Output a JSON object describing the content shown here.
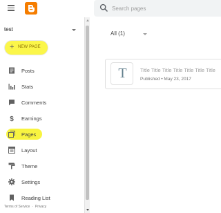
{
  "header": {
    "search_placeholder": "Search pages",
    "menu_icon": "hamburger-menu-icon",
    "logo_icon": "blogger-logo-icon",
    "search_icon": "search-icon",
    "logo_color": "#f57d00"
  },
  "sidebar": {
    "blog_name": "test",
    "new_page_label": "NEW PAGE",
    "items": [
      {
        "label": "Posts",
        "icon": "posts-icon"
      },
      {
        "label": "Stats",
        "icon": "stats-icon"
      },
      {
        "label": "Comments",
        "icon": "comments-icon"
      },
      {
        "label": "Earnings",
        "icon": "dollar-icon"
      },
      {
        "label": "Pages",
        "icon": "pages-icon",
        "active": true
      },
      {
        "label": "Layout",
        "icon": "layout-icon"
      },
      {
        "label": "Theme",
        "icon": "theme-icon"
      },
      {
        "label": "Settings",
        "icon": "gear-icon"
      },
      {
        "label": "Reading List",
        "icon": "bookmark-icon"
      }
    ],
    "footer": {
      "terms": "Terms of Service",
      "separator": "·",
      "privacy": "Privacy"
    },
    "highlight_color": "#f8f440"
  },
  "main": {
    "filter_label": "All (1)",
    "pages": [
      {
        "thumb_letter": "T",
        "title": "Title Title Title Title Title Title Title",
        "meta": "Published • May 23, 2017"
      }
    ]
  }
}
